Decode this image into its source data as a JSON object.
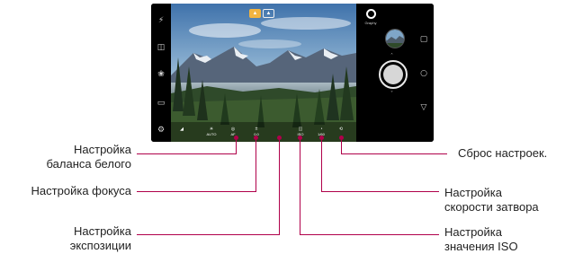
{
  "camera": {
    "brand_text": "Graphy",
    "modes": [
      "AUTO",
      "MANUAL"
    ],
    "left_icons": [
      "flash-off-icon",
      "switch-camera-icon",
      "filter-icon",
      "gallery-ratio-icon",
      "settings-icon"
    ],
    "manual_controls": [
      {
        "name": "wb",
        "text": "AUTO"
      },
      {
        "name": "focus",
        "text": "AF"
      },
      {
        "name": "exposure",
        "text": "0.0"
      },
      {
        "name": "iso",
        "text": "ISO"
      },
      {
        "name": "shutter",
        "text": "1/60"
      },
      {
        "name": "reset",
        "text": ""
      }
    ]
  },
  "callouts": {
    "white_balance": "Настройка\nбаланса белого",
    "white_balance_line1": "Настройка",
    "white_balance_line2": "баланса белого",
    "focus": "Настройка фокуса",
    "exposure_line1": "Настройка",
    "exposure_line2": "экспозиции",
    "reset": "Сброс настроек.",
    "shutter_line1": "Настройка",
    "shutter_line2": "скорости затвора",
    "iso_line1": "Настройка",
    "iso_line2": "значения ISO"
  },
  "colors": {
    "callout": "#b0004a",
    "sky_top": "#3d6fa8",
    "mode_active": "#f2b441"
  }
}
